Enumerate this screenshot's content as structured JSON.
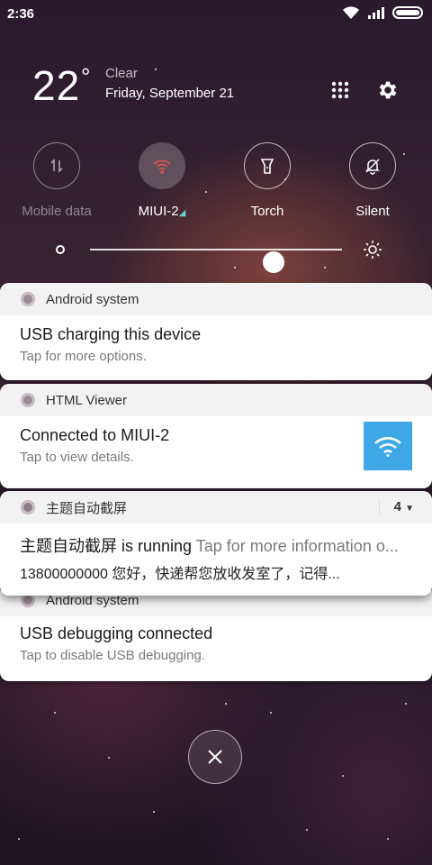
{
  "status_bar": {
    "time": "2:36"
  },
  "weather": {
    "temperature": "22",
    "degree_symbol": "°",
    "condition": "Clear",
    "date": "Friday, September 21"
  },
  "header_actions": [
    {
      "icon": "grid-icon"
    },
    {
      "icon": "gear-icon"
    }
  ],
  "toggles": [
    {
      "label": "Mobile data",
      "icon": "mobile-data-icon",
      "state": "off"
    },
    {
      "label": "MIUI-2",
      "icon": "wifi-icon",
      "state": "on"
    },
    {
      "label": "Torch",
      "icon": "torch-icon",
      "state": "off"
    },
    {
      "label": "Silent",
      "icon": "bell-off-icon",
      "state": "off"
    }
  ],
  "brightness": {
    "level": 0.73
  },
  "notifications": [
    {
      "app": "Android system",
      "title": "USB charging this device",
      "text": "Tap for more options."
    },
    {
      "app": "HTML Viewer",
      "title": "Connected to MIUI-2",
      "text": "Tap to view details."
    },
    {
      "app": "主题自动截屏",
      "count": "4",
      "title": "主题自动截屏 is running",
      "title_suffix": "Tap for more information o...",
      "text": "13800000000 您好，快递帮您放收发室了，记得..."
    },
    {
      "app": "Android system",
      "title": "USB debugging connected",
      "text": "Tap to disable USB debugging."
    }
  ],
  "colors": {
    "wifi_tile": "#3ea7e6",
    "card_header": "#f2f2f2"
  }
}
